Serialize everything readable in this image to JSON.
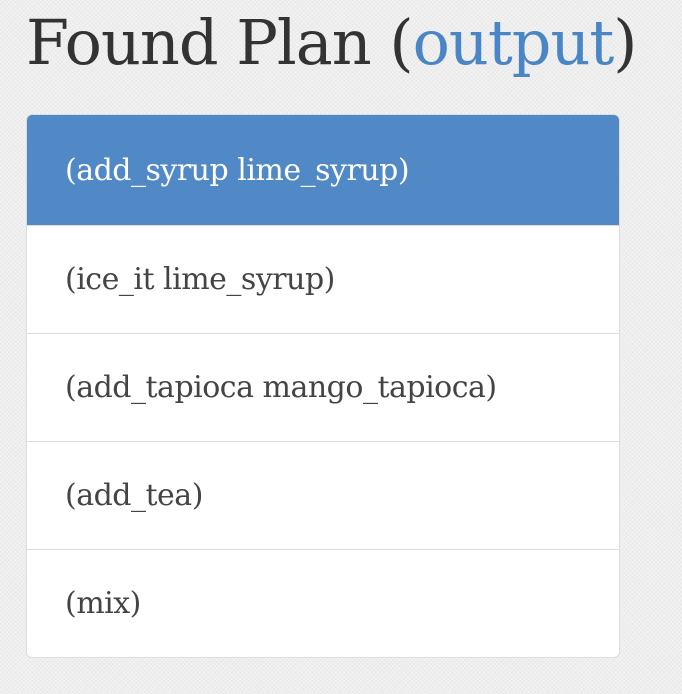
{
  "header": {
    "title": "Found Plan",
    "open_paren": "(",
    "link_label": "output",
    "close_paren": ")"
  },
  "plan": {
    "active_index": 0,
    "items": [
      {
        "label": "(add_syrup lime_syrup)"
      },
      {
        "label": "(ice_it lime_syrup)"
      },
      {
        "label": "(add_tapioca mango_tapioca)"
      },
      {
        "label": "(add_tea)"
      },
      {
        "label": "(mix)"
      }
    ]
  },
  "colors": {
    "accent": "#5189c6",
    "link": "#4a86c5",
    "text": "#333333"
  }
}
